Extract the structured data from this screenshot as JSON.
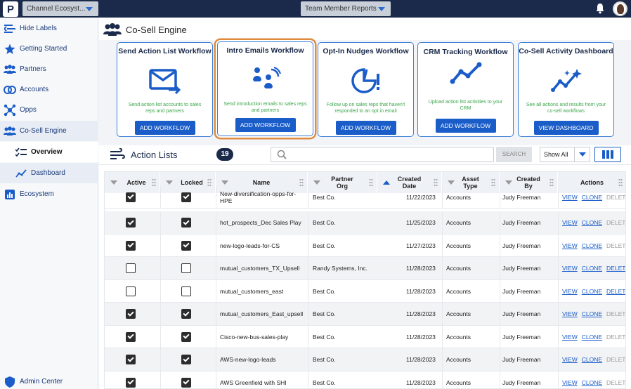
{
  "topbar": {
    "logo_letter": "P",
    "org_selector": "Channel Ecosyst...",
    "report_selector": "Team Member Reports"
  },
  "sidebar": {
    "items": [
      {
        "label": "Hide Labels",
        "icon": "collapse-icon"
      },
      {
        "label": "Getting Started",
        "icon": "star-icon"
      },
      {
        "label": "Partners",
        "icon": "partners-icon"
      },
      {
        "label": "Accounts",
        "icon": "accounts-icon"
      },
      {
        "label": "Opps",
        "icon": "opps-icon"
      },
      {
        "label": "Co-Sell Engine",
        "icon": "cosell-icon"
      }
    ],
    "sub_items": [
      {
        "label": "Overview",
        "icon": "list-icon"
      },
      {
        "label": "Dashboard",
        "icon": "chart-icon"
      }
    ],
    "ecosystem": "Ecosystem",
    "admin_center": "Admin Center"
  },
  "page": {
    "title": "Co-Sell Engine"
  },
  "cards": [
    {
      "title": "Send Action List Workflow",
      "desc": "Send action list accounts to sales reps and partners",
      "button": "ADD WORKFLOW"
    },
    {
      "title": "Intro Emails Workflow",
      "desc": "Send introduction emails to sales reps and partners",
      "button": "ADD WORKFLOW"
    },
    {
      "title": "Opt-In Nudges Workflow",
      "desc": "Follow up on sales reps that haven't responded to an opt in email",
      "button": "ADD WORKFLOW"
    },
    {
      "title": "CRM Tracking Workflow",
      "desc": "Upload action list activities to your CRM",
      "button": "ADD WORKFLOW"
    },
    {
      "title": "Co-Sell Activity Dashboard",
      "desc": "See all actions and results from your co-sell workflows",
      "button": "VIEW DASHBOARD"
    }
  ],
  "toolbar": {
    "title": "Action Lists",
    "count": "19",
    "search_placeholder": "",
    "search_button": "SEARCH",
    "show_all": "Show All"
  },
  "table": {
    "headers": [
      "Active",
      "Locked",
      "Name",
      "Partner Org",
      "Created Date",
      "Asset Type",
      "Created By",
      "Actions"
    ],
    "rows": [
      {
        "active": true,
        "locked": true,
        "name": "New-diversification-opps-for-HPE",
        "partner": "Best Co.",
        "date": "11/22/2023",
        "type": "Accounts",
        "by": "Judy Freeman",
        "delete_enabled": false
      },
      {
        "active": true,
        "locked": true,
        "name": "hot_prospects_Dec Sales Play",
        "partner": "Best Co.",
        "date": "11/25/2023",
        "type": "Accounts",
        "by": "Judy Freeman",
        "delete_enabled": false
      },
      {
        "active": true,
        "locked": true,
        "name": "new-logo-leads-for-CS",
        "partner": "Best Co.",
        "date": "11/27/2023",
        "type": "Accounts",
        "by": "Judy Freeman",
        "delete_enabled": false
      },
      {
        "active": false,
        "locked": false,
        "name": "mutual_customers_TX_Upsell",
        "partner": "Randy Systems, Inc.",
        "date": "11/28/2023",
        "type": "Accounts",
        "by": "Judy Freeman",
        "delete_enabled": true
      },
      {
        "active": false,
        "locked": false,
        "name": "mutual_customers_east",
        "partner": "Best Co.",
        "date": "11/28/2023",
        "type": "Accounts",
        "by": "Judy Freeman",
        "delete_enabled": true
      },
      {
        "active": true,
        "locked": true,
        "name": "mutual_customers_East_upsell",
        "partner": "Best Co.",
        "date": "11/28/2023",
        "type": "Accounts",
        "by": "Judy Freeman",
        "delete_enabled": false
      },
      {
        "active": true,
        "locked": true,
        "name": "Cisco-new-bus-sales-play",
        "partner": "Best Co.",
        "date": "11/28/2023",
        "type": "Accounts",
        "by": "Judy Freeman",
        "delete_enabled": false
      },
      {
        "active": true,
        "locked": true,
        "name": "AWS-new-logo-leads",
        "partner": "Best Co.",
        "date": "11/28/2023",
        "type": "Accounts",
        "by": "Judy Freeman",
        "delete_enabled": false
      },
      {
        "active": true,
        "locked": true,
        "name": "AWS Greenfield with SHI",
        "partner": "Best Co.",
        "date": "11/28/2023",
        "type": "Accounts",
        "by": "Judy Freeman",
        "delete_enabled": false
      }
    ],
    "action_labels": {
      "view": "VIEW",
      "clone": "CLONE",
      "delete": "DELETE"
    }
  }
}
